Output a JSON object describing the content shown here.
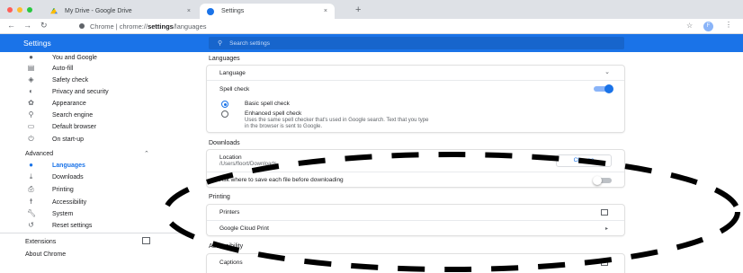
{
  "browser": {
    "tabs": [
      {
        "title": "My Drive - Google Drive",
        "icon": "google-drive-icon"
      },
      {
        "title": "Settings",
        "icon": "settings-gear-icon"
      }
    ],
    "close_glyph": "×",
    "new_tab_glyph": "+",
    "url_scheme": "Chrome  |  chrome://",
    "url_bold": "settings",
    "url_rest": "/languages",
    "profile_initial": "F"
  },
  "header": {
    "title": "Settings",
    "search_placeholder": "Search settings"
  },
  "sidebar": {
    "items": [
      {
        "label": "You and Google",
        "icon": "person-icon"
      },
      {
        "label": "Auto-fill",
        "icon": "clipboard-icon"
      },
      {
        "label": "Safety check",
        "icon": "shield-icon"
      },
      {
        "label": "Privacy and security",
        "icon": "shield-lock-icon"
      },
      {
        "label": "Appearance",
        "icon": "palette-icon"
      },
      {
        "label": "Search engine",
        "icon": "search-icon"
      },
      {
        "label": "Default browser",
        "icon": "browser-icon"
      },
      {
        "label": "On start-up",
        "icon": "power-icon"
      }
    ],
    "advanced_label": "Advanced",
    "advanced_items": [
      {
        "label": "Languages",
        "icon": "globe-icon",
        "active": true
      },
      {
        "label": "Downloads",
        "icon": "download-icon"
      },
      {
        "label": "Printing",
        "icon": "printer-icon"
      },
      {
        "label": "Accessibility",
        "icon": "accessibility-icon"
      },
      {
        "label": "System",
        "icon": "wrench-icon"
      },
      {
        "label": "Reset settings",
        "icon": "reset-icon"
      }
    ],
    "extensions_label": "Extensions",
    "about_label": "About Chrome"
  },
  "languages": {
    "section_title": "Languages",
    "language_label": "Language",
    "spell_check_label": "Spell check",
    "spell_check_on": true,
    "basic_label": "Basic spell check",
    "enhanced_label": "Enhanced spell check",
    "enhanced_desc_1": "Uses the same spell checker that's used in Google search. Text that you type",
    "enhanced_desc_2": "in the browser is sent to Google."
  },
  "downloads": {
    "section_title": "Downloads",
    "location_label": "Location",
    "location_path": "/Users/floort/Downloads",
    "change_button": "Change",
    "ask_label": "Ask where to save each file before downloading",
    "ask_on": false
  },
  "printing": {
    "section_title": "Printing",
    "printers_label": "Printers",
    "cloud_print_label": "Google Cloud Print"
  },
  "accessibility": {
    "section_title": "Accessibility",
    "captions_label": "Captions"
  },
  "colors": {
    "accent": "#1a73e8",
    "header_bg": "#1a73e8",
    "tabbar_bg": "#dee1e6"
  }
}
